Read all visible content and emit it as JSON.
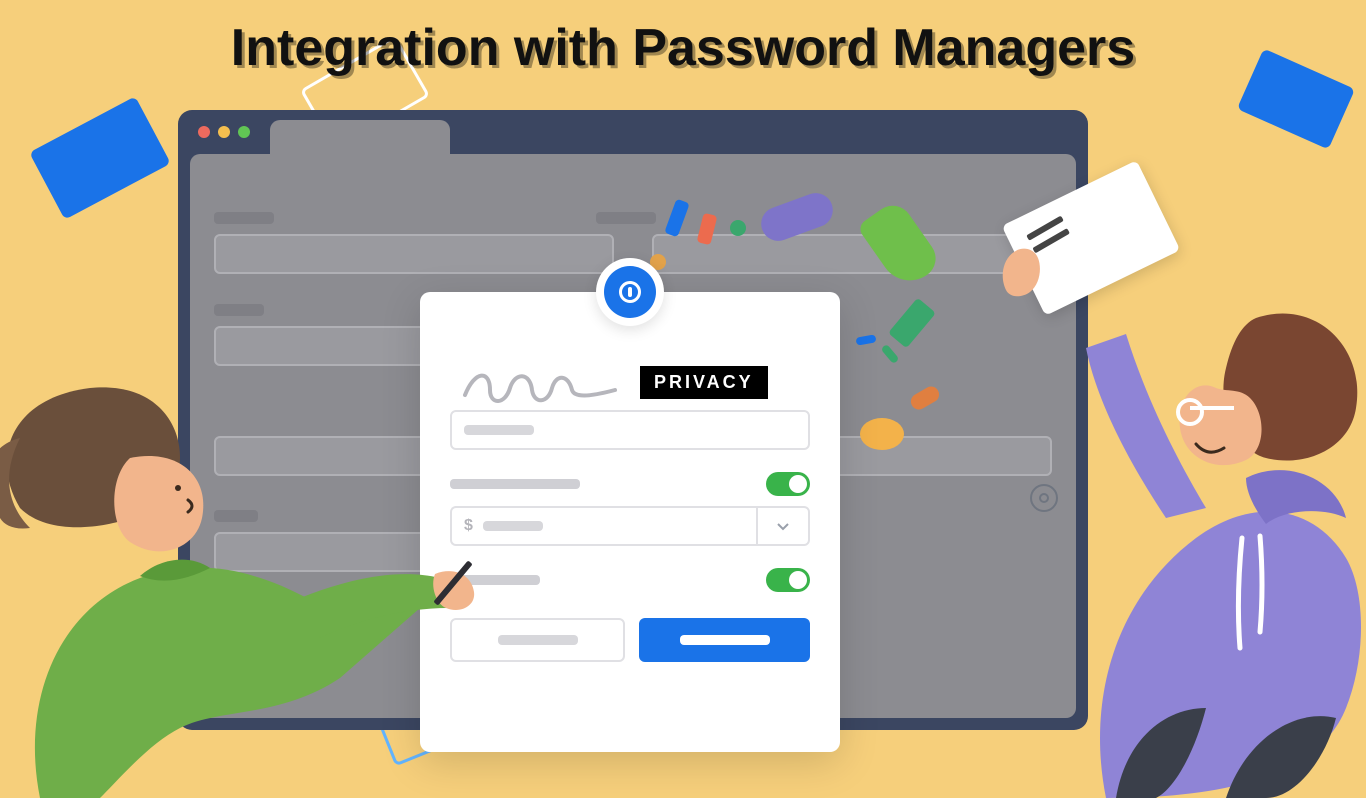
{
  "page": {
    "title": "Integration with Password Managers",
    "privacy_label": "PRIVACY"
  },
  "icons": {
    "circle_badge": "1password-keyhole-icon",
    "bg_badge": "password-manager-badge-icon"
  },
  "modal": {
    "toggle1_on": true,
    "toggle2_on": true,
    "select_prefix": "$"
  },
  "colors": {
    "bg": "#f6cf7b",
    "browser": "#3b4661",
    "viewport": "#8c8c91",
    "accent_blue": "#1a73e8",
    "toggle_green": "#39b34a"
  }
}
